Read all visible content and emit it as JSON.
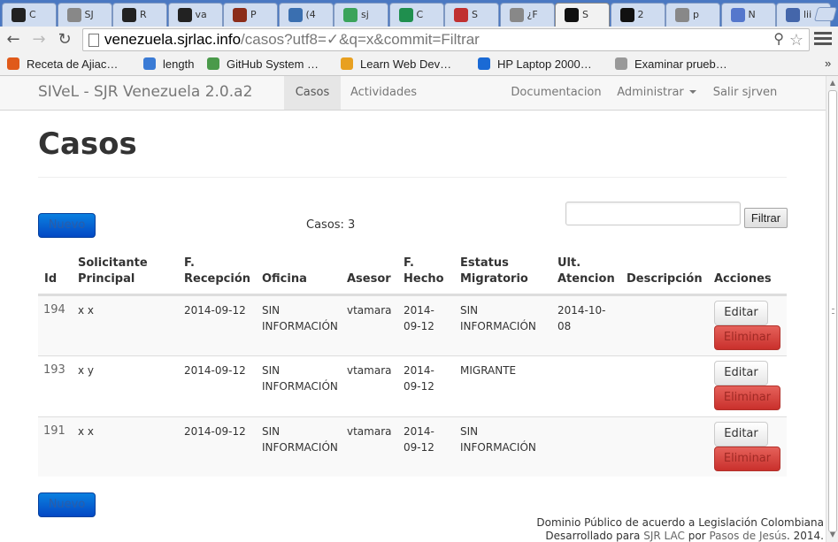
{
  "browser": {
    "tabs": [
      {
        "title": "C",
        "icon": "github-icon",
        "color": "#222222"
      },
      {
        "title": "SJ",
        "icon": "page-icon",
        "color": "#888888"
      },
      {
        "title": "R",
        "icon": "github-icon",
        "color": "#222222"
      },
      {
        "title": "va",
        "icon": "github-icon",
        "color": "#222222"
      },
      {
        "title": "P",
        "icon": "circle-icon",
        "color": "#8b2d1a"
      },
      {
        "title": "(4",
        "icon": "globe-icon",
        "color": "#3a6fb0"
      },
      {
        "title": "sj",
        "icon": "drive-icon",
        "color": "#3aa35b"
      },
      {
        "title": "C",
        "icon": "sheets-icon",
        "color": "#1f8f4e"
      },
      {
        "title": "S",
        "icon": "s-icon",
        "color": "#c03030"
      },
      {
        "title": "¿F",
        "icon": "page-icon",
        "color": "#888888"
      },
      {
        "title": "S",
        "icon": "site-icon",
        "color": "#111111"
      },
      {
        "title": "2",
        "icon": "site-icon",
        "color": "#111111"
      },
      {
        "title": "p",
        "icon": "page-icon",
        "color": "#888888"
      },
      {
        "title": "N",
        "icon": "hand-icon",
        "color": "#5577cc"
      },
      {
        "title": "lii",
        "icon": "a-icon",
        "color": "#4466aa"
      }
    ],
    "url_host": "venezuela.sjrlac.info",
    "url_path": "/casos?utf8=✓&q=x&commit=Filtrar",
    "bookmarks": [
      {
        "label": "Receta de Ajiac…",
        "icon": "s-icon",
        "color": "#e05a1a"
      },
      {
        "label": "length",
        "icon": "page-icon",
        "color": "#3a7bd5"
      },
      {
        "label": "GitHub System …",
        "icon": "github-icon",
        "color": "#4a9a4a"
      },
      {
        "label": "Learn Web Dev…",
        "icon": "circle-icon",
        "color": "#e8a020"
      },
      {
        "label": "HP Laptop 2000…",
        "icon": "info-icon",
        "color": "#1a6ad5"
      },
      {
        "label": "Examinar prueb…",
        "icon": "page-icon",
        "color": "#999999"
      }
    ],
    "bookmarks_more": "»"
  },
  "navbar": {
    "brand": "SIVeL - SJR Venezuela 2.0.a2",
    "casos": "Casos",
    "actividades": "Actividades",
    "documentacion": "Documentacion",
    "administrar": "Administrar",
    "salir": "Salir sjrven"
  },
  "page": {
    "title": "Casos",
    "nuevo_label": "Nuevo",
    "count_text": "Casos: 3",
    "search_value": "",
    "filtrar_label": "Filtrar"
  },
  "table": {
    "headers": {
      "id": "Id",
      "solicitante": [
        "Solicitante",
        "Principal"
      ],
      "recepcion": [
        "F.",
        "Recepción"
      ],
      "oficina": "Oficina",
      "asesor": "Asesor",
      "hecho": [
        "F.",
        "Hecho"
      ],
      "estatus": [
        "Estatus",
        "Migratorio"
      ],
      "atencion": [
        "Ult.",
        "Atencion"
      ],
      "descripcion": "Descripción",
      "acciones": "Acciones"
    },
    "rows": [
      {
        "id": "194",
        "solicitante": "x x",
        "recepcion": "2014-09-12",
        "oficina": [
          "SIN",
          "INFORMACIÓN"
        ],
        "asesor": "vtamara",
        "hecho": [
          "2014-",
          "09-12"
        ],
        "estatus": [
          "SIN",
          "INFORMACIÓN"
        ],
        "atencion": [
          "2014-10-",
          "08"
        ],
        "descripcion": "",
        "editar": "Editar",
        "eliminar": "Eliminar"
      },
      {
        "id": "193",
        "solicitante": "x y",
        "recepcion": "2014-09-12",
        "oficina": [
          "SIN",
          "INFORMACIÓN"
        ],
        "asesor": "vtamara",
        "hecho": [
          "2014-",
          "09-12"
        ],
        "estatus": [
          "MIGRANTE",
          ""
        ],
        "atencion": [
          "",
          ""
        ],
        "descripcion": "",
        "editar": "Editar",
        "eliminar": "Eliminar"
      },
      {
        "id": "191",
        "solicitante": "x x",
        "recepcion": "2014-09-12",
        "oficina": [
          "SIN",
          "INFORMACIÓN"
        ],
        "asesor": "vtamara",
        "hecho": [
          "2014-",
          "09-12"
        ],
        "estatus": [
          "SIN",
          "INFORMACIÓN"
        ],
        "atencion": [
          "",
          ""
        ],
        "descripcion": "",
        "editar": "Editar",
        "eliminar": "Eliminar"
      }
    ]
  },
  "footer": {
    "line1": "Dominio Público de acuerdo a Legislación Colombiana",
    "line2_prefix": "Desarrollado para",
    "line2_link1": "SJR LAC",
    "line2_mid": "por",
    "line2_link2": "Pasos de Jesús",
    "line2_suffix": ". 2014."
  }
}
